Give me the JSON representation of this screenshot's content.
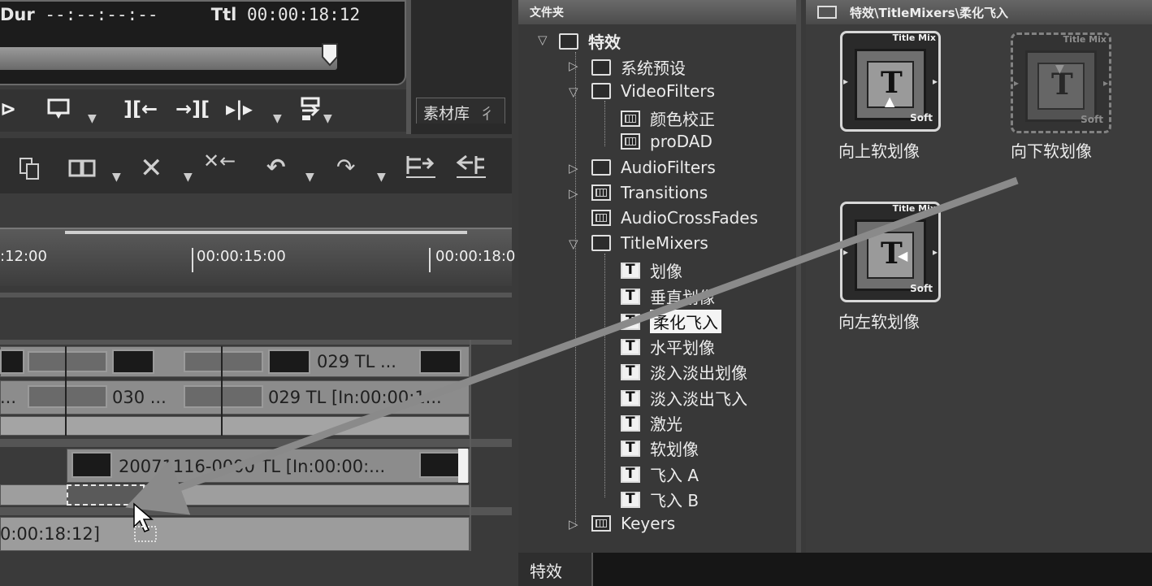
{
  "monitor": {
    "dur_label": "Dur",
    "dur_value": "--:--:--:--",
    "ttl_label": "Ttl",
    "ttl_value": "00:00:18:12"
  },
  "library_tab": "素材库",
  "library_tab_cut": "彳",
  "ruler": {
    "labels": [
      ":12:00",
      "00:00:15:00",
      "00:00:18:0"
    ]
  },
  "timeline": {
    "clip_029_a": "029  TL ...",
    "clip_030": "030   ...",
    "clip_029_b": "029  TL [In:00:00:1...",
    "clip_2007": "20071116-0000  TL [In:00:00:...",
    "dur_text": "0:00:18:12]",
    "prefix_a": "...",
    "prefix_b": "."
  },
  "folder_panel": {
    "header": "文件夹",
    "bottom_tab": "特效",
    "tree": [
      {
        "label": "特效",
        "icon": "folder-open-icon"
      },
      {
        "label": "系统预设",
        "icon": "folder-icon"
      },
      {
        "label": "VideoFilters",
        "icon": "folder-open-icon"
      },
      {
        "label": "颜色校正",
        "icon": "grid-icon"
      },
      {
        "label": "proDAD",
        "icon": "grid-icon"
      },
      {
        "label": "AudioFilters",
        "icon": "folder-icon"
      },
      {
        "label": "Transitions",
        "icon": "folder-icon"
      },
      {
        "label": "AudioCrossFades",
        "icon": "folder-icon"
      },
      {
        "label": "TitleMixers",
        "icon": "folder-open-icon"
      },
      {
        "label": "划像",
        "icon": "title-icon"
      },
      {
        "label": "垂直划像",
        "icon": "title-icon"
      },
      {
        "label": "柔化飞入",
        "icon": "title-icon"
      },
      {
        "label": "水平划像",
        "icon": "title-icon"
      },
      {
        "label": "淡入淡出划像",
        "icon": "title-icon"
      },
      {
        "label": "淡入淡出飞入",
        "icon": "title-icon"
      },
      {
        "label": "激光",
        "icon": "title-icon"
      },
      {
        "label": "软划像",
        "icon": "title-icon"
      },
      {
        "label": "飞入 A",
        "icon": "title-icon"
      },
      {
        "label": "飞入 B",
        "icon": "title-icon"
      },
      {
        "label": "Keyers",
        "icon": "folder-icon"
      }
    ],
    "selected": "柔化飞入"
  },
  "content_panel": {
    "path": "特效\\TitleMixers\\柔化飞入",
    "items": [
      {
        "label": "向上软划像",
        "tag": "Title Mix",
        "soft": "Soft",
        "arrow": "up"
      },
      {
        "label": "向下软划像",
        "tag": "Title Mix",
        "soft": "Soft",
        "arrow": "down"
      },
      {
        "label": "向左软划像",
        "tag": "Title Mix",
        "soft": "Soft",
        "arrow": "left"
      }
    ]
  },
  "colors": {
    "panel_bg": "#383838",
    "selection_bg": "#f4f4f4",
    "drag_line": "#8a8a8a"
  }
}
